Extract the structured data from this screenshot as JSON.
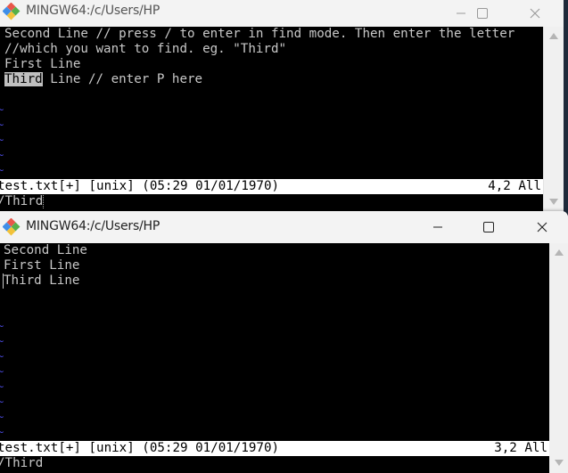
{
  "windows": [
    {
      "title": "MINGW64:/c/Users/HP",
      "icon": "git-bash-icon",
      "controls": {
        "minimize": "minimize-icon",
        "maximize": "maximize-icon",
        "close": "close-icon"
      },
      "lines": [
        {
          "pre": "",
          "highlight": "",
          "post": "Second Line // press / to enter in find mode. Then enter the letter"
        },
        {
          "pre": "",
          "highlight": "",
          "post": "//which you want to find. eg. \"Third\""
        },
        {
          "pre": "",
          "highlight": "",
          "post": "First Line"
        },
        {
          "pre": "",
          "highlight": "Third",
          "post": " Line // enter P here"
        }
      ],
      "tilde": "~",
      "tilde_count": 5,
      "status_left": "test.txt[+] [unix] (05:29 01/01/1970)",
      "status_right": "4,2 All",
      "command_line": "/Third"
    },
    {
      "title": "MINGW64:/c/Users/HP",
      "icon": "git-bash-icon",
      "controls": {
        "minimize": "minimize-icon",
        "maximize": "maximize-icon",
        "close": "close-icon"
      },
      "lines": [
        {
          "text": "Second Line"
        },
        {
          "text": "First Line"
        },
        {
          "text": "Third Line"
        }
      ],
      "tilde": "~",
      "tilde_count": 8,
      "status_left": "test.txt[+] [unix] (05:29 01/01/1970)",
      "status_right": "3,2 All",
      "command_line": "/Third"
    }
  ]
}
